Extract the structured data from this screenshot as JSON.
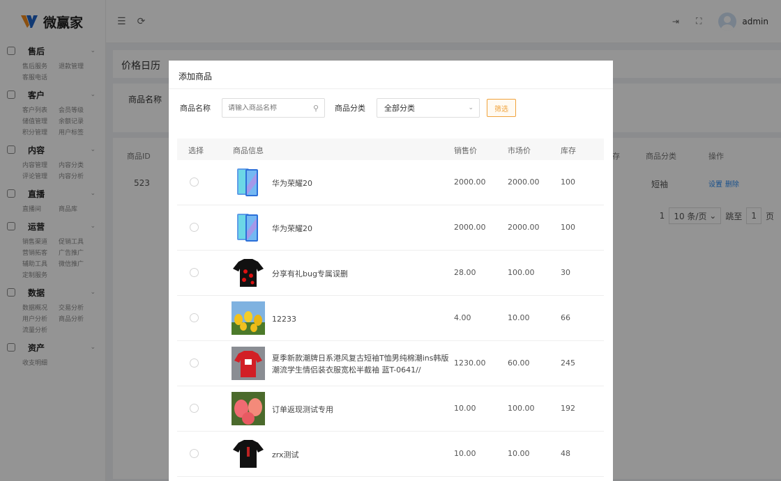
{
  "app": {
    "logo_text": "微赢家",
    "username": "admin"
  },
  "sidebar": {
    "groups": [
      {
        "title": "售后",
        "items": [
          "售后服务",
          "退款管理",
          "客服电话"
        ]
      },
      {
        "title": "客户",
        "items": [
          "客户列表",
          "会员等级",
          "储值管理",
          "余额记录",
          "积分管理",
          "用户标签"
        ]
      },
      {
        "title": "内容",
        "items": [
          "内容管理",
          "内容分类",
          "评论管理",
          "内容分析"
        ]
      },
      {
        "title": "直播",
        "items": [
          "直播间",
          "商品库"
        ]
      },
      {
        "title": "运营",
        "items": [
          "销售渠道",
          "促销工具",
          "营销拓客",
          "广告推广",
          "辅助工具",
          "微信推广",
          "定制服务"
        ]
      },
      {
        "title": "数据",
        "items": [
          "数据概况",
          "交易分析",
          "用户分析",
          "商品分析",
          "流量分析"
        ]
      },
      {
        "title": "资产",
        "items": [
          "收支明细"
        ]
      }
    ]
  },
  "background": {
    "page_title": "价格日历",
    "filter_label": "商品名称",
    "columns": {
      "id": "商品ID",
      "stock": "存",
      "category": "商品分类",
      "action": "操作"
    },
    "row": {
      "id": "523",
      "category": "短袖",
      "set": "设置",
      "delete": "删除"
    },
    "pager": {
      "page": "1",
      "per_page": "10 条/页",
      "goto": "跳至",
      "goto_value": "1",
      "page_suffix": "页"
    }
  },
  "modal": {
    "title": "添加商品",
    "name_label": "商品名称",
    "name_placeholder": "请输入商品名称",
    "category_label": "商品分类",
    "category_value": "全部分类",
    "filter_button": "筛选",
    "columns": {
      "select": "选择",
      "info": "商品信息",
      "sale": "销售价",
      "market": "市场价",
      "stock": "库存"
    },
    "rows": [
      {
        "name": "华为荣耀20",
        "sale": "2000.00",
        "market": "2000.00",
        "stock": "100",
        "thumb": "phone"
      },
      {
        "name": "华为荣耀20",
        "sale": "2000.00",
        "market": "2000.00",
        "stock": "100",
        "thumb": "phone"
      },
      {
        "name": "分享有礼bug专属误删",
        "sale": "28.00",
        "market": "100.00",
        "stock": "30",
        "thumb": "tshirt-red"
      },
      {
        "name": "12233",
        "sale": "4.00",
        "market": "10.00",
        "stock": "66",
        "thumb": "tulips"
      },
      {
        "name": "夏季新款潮牌日系港风复古短袖T恤男纯棉潮ins韩版潮流学生情侣装衣服宽松半截袖 蓝T-0641//",
        "sale": "1230.00",
        "market": "60.00",
        "stock": "245",
        "thumb": "red-shirt"
      },
      {
        "name": "订单返现测试专用",
        "sale": "10.00",
        "market": "100.00",
        "stock": "192",
        "thumb": "peaches"
      },
      {
        "name": "zrx测试",
        "sale": "10.00",
        "market": "10.00",
        "stock": "48",
        "thumb": "tshirt-black"
      }
    ]
  }
}
